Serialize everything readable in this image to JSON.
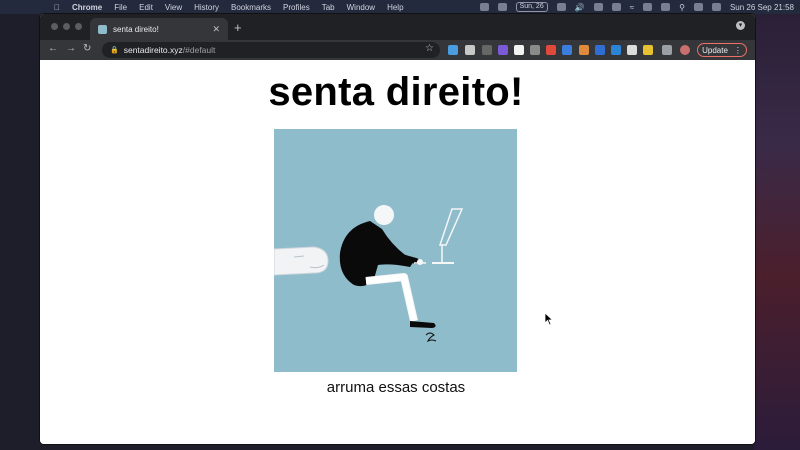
{
  "menubar": {
    "app_name": "Chrome",
    "items": [
      "File",
      "Edit",
      "View",
      "History",
      "Bookmarks",
      "Profiles",
      "Tab",
      "Window",
      "Help"
    ],
    "date_badge": "Sun, 26",
    "clock": "Sun 26 Sep  21:58"
  },
  "browser": {
    "tab_title": "senta direito!",
    "url_domain": "sentadireito.xyz",
    "url_path": "/#default",
    "update_label": "Update"
  },
  "page": {
    "heading": "senta direito!",
    "caption": "arruma essas costas"
  },
  "colors": {
    "illustration_bg": "#8fbccb",
    "update_border": "#e8716a"
  }
}
